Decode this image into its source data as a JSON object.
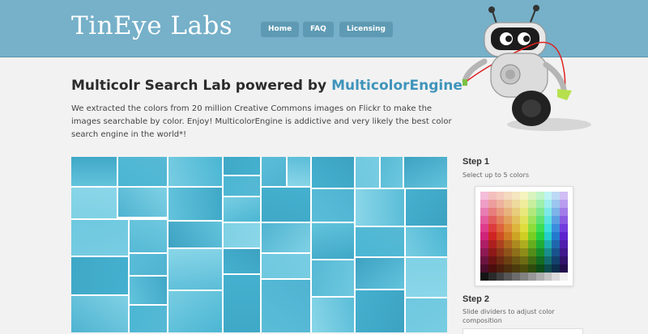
{
  "header": {
    "logo": "TinEye Labs",
    "nav": [
      {
        "label": "Home"
      },
      {
        "label": "FAQ"
      },
      {
        "label": "Licensing"
      }
    ]
  },
  "main": {
    "title_prefix": "Multicolr Search Lab powered by ",
    "title_link": "MulticolorEngine",
    "description": "We extracted the colors from 20 million Creative Commons images on Flickr to make the images searchable by color. Enjoy! MulticolorEngine is addictive and very likely the best color search engine in the world*!"
  },
  "sidebar": {
    "step1_title": "Step 1",
    "step1_text": "Select up to 5 colors",
    "step2_title": "Step 2",
    "step2_text": "Slide dividers to adjust color composition"
  },
  "colors": {
    "header_bg": "#76b0c9",
    "nav_bg": "#5e9ab3",
    "accent": "#3f94bb",
    "result_tile": "#52bcd8"
  },
  "icons": {
    "mascot": "robot-mascot-icon"
  }
}
